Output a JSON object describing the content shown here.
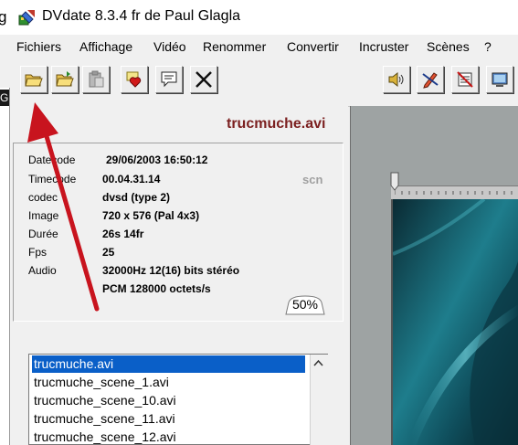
{
  "window": {
    "edge_char": "g",
    "title": "DVdate 8.3.4 fr de Paul Glagla"
  },
  "menu": {
    "items": [
      "Fichiers",
      "Affichage",
      "Vidéo",
      "Renommer",
      "Convertir",
      "Incruster",
      "Scènes",
      "?"
    ]
  },
  "left_edge": {
    "char": "Gl"
  },
  "file_info": {
    "filename": "trucmuche.avi",
    "scn_label": "scn",
    "rows": [
      {
        "label": "Datecode",
        "value": "29/06/2003 16:50:12"
      },
      {
        "label": "Timecode",
        "value": "00.04.31.14"
      },
      {
        "label": "codec",
        "value": "dvsd (type 2)"
      },
      {
        "label": "Image",
        "value": "720 x 576 (Pal 4x3)"
      },
      {
        "label": "Durée",
        "value": "26s 14fr"
      },
      {
        "label": "Fps",
        "value": "25"
      },
      {
        "label": "Audio",
        "value": "32000Hz 12(16) bits  stéréo"
      },
      {
        "label": "",
        "value": "PCM 128000 octets/s"
      }
    ],
    "percent": "50%"
  },
  "file_list": {
    "items": [
      "trucmuche.avi",
      "trucmuche_scene_1.avi",
      "trucmuche_scene_10.avi",
      "trucmuche_scene_11.avi",
      "trucmuche_scene_12.avi"
    ],
    "selected_index": 0
  },
  "colors": {
    "filename": "#7b1f1f",
    "selection": "#0a5fc8",
    "annotation_arrow": "#c8141e"
  }
}
